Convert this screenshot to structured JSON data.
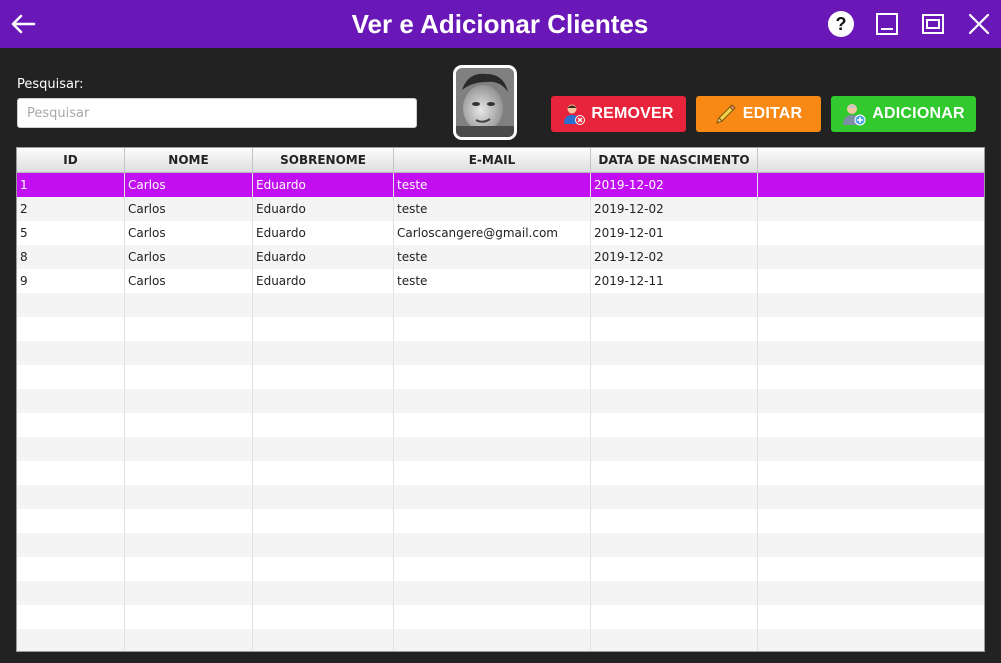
{
  "window": {
    "title": "Ver e Adicionar Clientes"
  },
  "search": {
    "label": "Pesquisar:",
    "placeholder": "Pesquisar",
    "value": ""
  },
  "buttons": {
    "remove": "REMOVER",
    "edit": "EDITAR",
    "add": "ADICIONAR"
  },
  "colors": {
    "titlebar": "#6a17b8",
    "selection": "#c20ff2",
    "remove": "#e8243c",
    "edit": "#f78914",
    "add": "#31c92d"
  },
  "table": {
    "columns": [
      "ID",
      "NOME",
      "SOBRENOME",
      "E-MAIL",
      "DATA DE NASCIMENTO"
    ],
    "rows": [
      [
        "1",
        "Carlos",
        "Eduardo",
        "teste",
        "2019-12-02"
      ],
      [
        "2",
        "Carlos",
        "Eduardo",
        "teste",
        "2019-12-02"
      ],
      [
        "5",
        "Carlos",
        "Eduardo",
        "Carloscangere@gmail.com",
        "2019-12-01"
      ],
      [
        "8",
        "Carlos",
        "Eduardo",
        "teste",
        "2019-12-02"
      ],
      [
        "9",
        "Carlos",
        "Eduardo",
        "teste",
        "2019-12-11"
      ]
    ],
    "selected_row": 0
  }
}
